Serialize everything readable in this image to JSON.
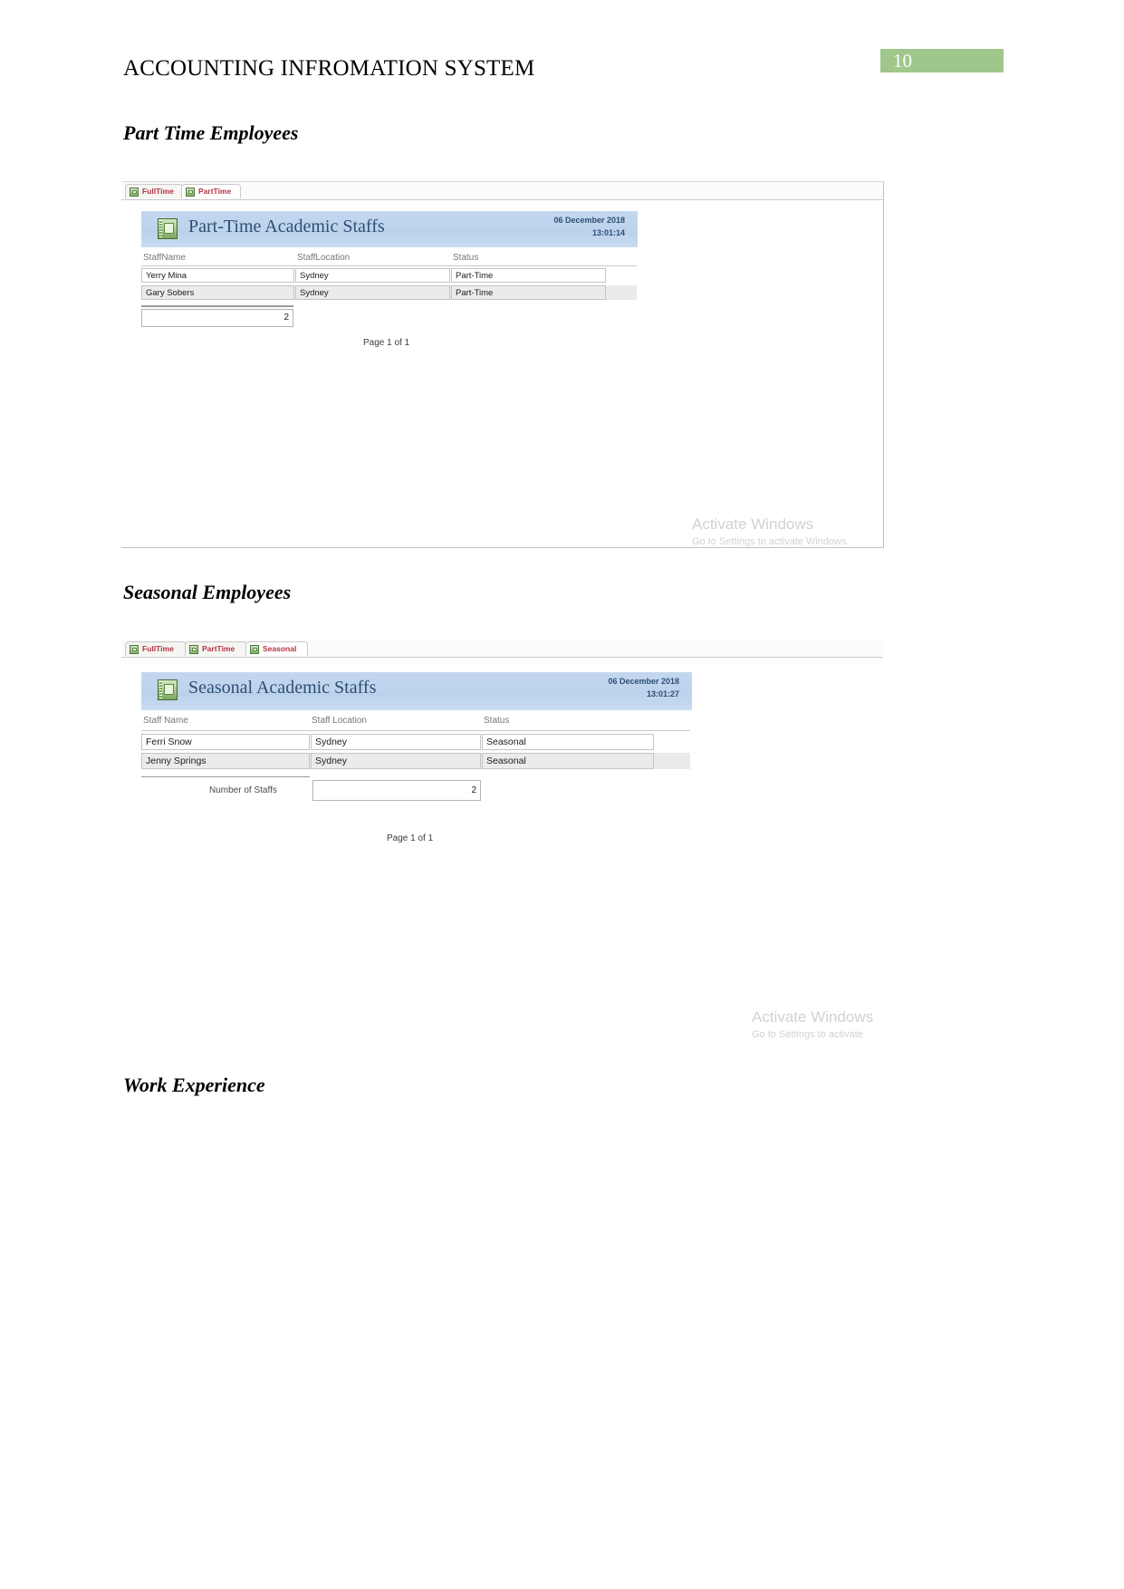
{
  "document": {
    "header_title": "ACCOUNTING INFROMATION SYSTEM",
    "page_number": "10",
    "page_badge_color": "#9fc78c"
  },
  "sections": {
    "part_time": "Part Time Employees",
    "seasonal": "Seasonal Employees",
    "work_experience": "Work Experience"
  },
  "parttime_screenshot": {
    "tabs": [
      {
        "label": "FullTime",
        "active": false
      },
      {
        "label": "PartTime",
        "active": true
      }
    ],
    "report": {
      "title": "Part-Time Academic Staffs",
      "date": "06 December 2018",
      "time": "13:01:14",
      "columns": [
        "StaffName",
        "StaffLocation",
        "Status"
      ],
      "rows": [
        [
          "Yerry Mina",
          "Sydney",
          "Part-Time"
        ],
        [
          "Gary Sobers",
          "Sydney",
          "Part-Time"
        ]
      ],
      "count_value": "2",
      "count_label": "",
      "page_footer": "Page 1 of 1"
    },
    "watermark": {
      "title": "Activate Windows",
      "subtitle": "Go to Settings to activate Windows."
    }
  },
  "seasonal_screenshot": {
    "tabs": [
      {
        "label": "FullTime",
        "active": false
      },
      {
        "label": "PartTime",
        "active": false
      },
      {
        "label": "Seasonal",
        "active": true
      }
    ],
    "report": {
      "title": "Seasonal Academic Staffs",
      "date": "06 December 2018",
      "time": "13:01:27",
      "columns": [
        "Staff Name",
        "Staff Location",
        "Status"
      ],
      "rows": [
        [
          "Ferri Snow",
          "Sydney",
          "Seasonal"
        ],
        [
          "Jenny Springs",
          "Sydney",
          "Seasonal"
        ]
      ],
      "count_value": "2",
      "count_label": "Number of Staffs",
      "page_footer": "Page 1 of 1"
    },
    "watermark": {
      "title": "Activate Windows",
      "subtitle": "Go to Settings to activate"
    }
  }
}
